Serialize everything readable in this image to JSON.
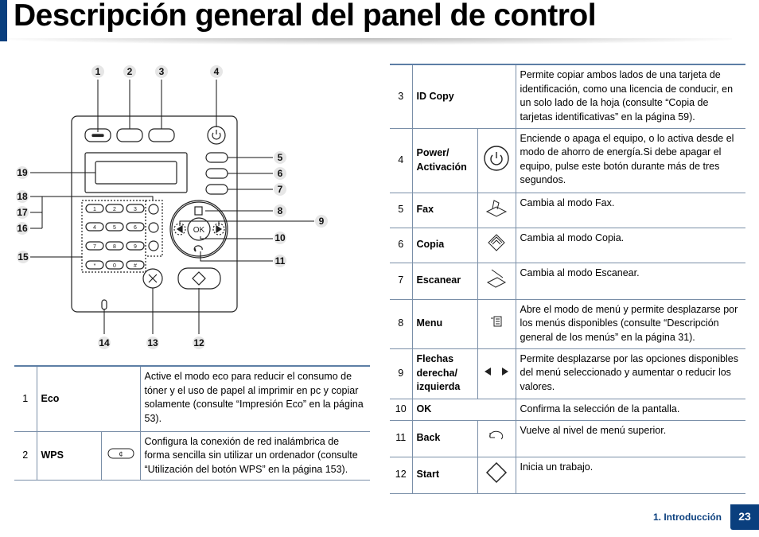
{
  "title": "Descripción general del panel de control",
  "callouts": [
    "1",
    "2",
    "3",
    "4",
    "5",
    "6",
    "7",
    "8",
    "9",
    "10",
    "11",
    "12",
    "13",
    "14",
    "15",
    "16",
    "17",
    "18",
    "19"
  ],
  "keypad": [
    "1",
    "2",
    "3",
    "4",
    "5",
    "6",
    "7",
    "8",
    "9",
    "*",
    "0",
    "#"
  ],
  "ok_label": "OK",
  "left_table": [
    {
      "num": "1",
      "name": "Eco",
      "icon": "",
      "desc": "Active el modo eco para reducir el consumo de tóner y el uso de papel al imprimir en pc y copiar solamente (consulte “Impresión Eco” en la página 53)."
    },
    {
      "num": "2",
      "name": "WPS",
      "icon": "wps-button-icon",
      "desc": "Configura la conexión de red inalámbrica de forma sencilla sin utilizar un ordenador (consulte “Utilización del botón WPS” en la página 153)."
    }
  ],
  "right_table": [
    {
      "num": "3",
      "name": "ID Copy",
      "icon": "",
      "desc": "Permite copiar ambos lados de una tarjeta de identificación, como una licencia de conducir, en un solo lado de la hoja (consulte “Copia de tarjetas identificativas” en la página 59)."
    },
    {
      "num": "4",
      "name": "Power/ Activación",
      "icon": "power-icon",
      "desc": "Enciende o apaga el equipo, o lo activa desde el modo de ahorro de energía.Si debe apagar el equipo, pulse este botón durante más de tres segundos."
    },
    {
      "num": "5",
      "name": "Fax",
      "icon": "fax-icon",
      "desc": "Cambia al modo Fax."
    },
    {
      "num": "6",
      "name": "Copia",
      "icon": "copy-icon",
      "desc": "Cambia al modo Copia."
    },
    {
      "num": "7",
      "name": "Escanear",
      "icon": "scan-icon",
      "desc": "Cambia al modo Escanear."
    },
    {
      "num": "8",
      "name": "Menu",
      "icon": "menu-icon",
      "desc": "Abre el modo de menú y permite desplazarse por los menús disponibles (consulte “Descripción general de los menús” en la página 31)."
    },
    {
      "num": "9",
      "name": "Flechas derecha/ izquierda",
      "icon": "arrows-icon",
      "desc": "Permite desplazarse por las opciones disponibles del menú seleccionado y aumentar o reducir los valores."
    },
    {
      "num": "10",
      "name": "OK",
      "icon": "",
      "desc": "Confirma la selección de la pantalla."
    },
    {
      "num": "11",
      "name": "Back",
      "icon": "back-icon",
      "desc": "Vuelve al nivel de menú superior."
    },
    {
      "num": "12",
      "name": "Start",
      "icon": "start-icon",
      "desc": "Inicia un trabajo."
    }
  ],
  "footer": {
    "section": "1. Introducción",
    "page": "23"
  },
  "colors": {
    "brand": "#0a3f7e",
    "rule": "#5d7ea5"
  }
}
